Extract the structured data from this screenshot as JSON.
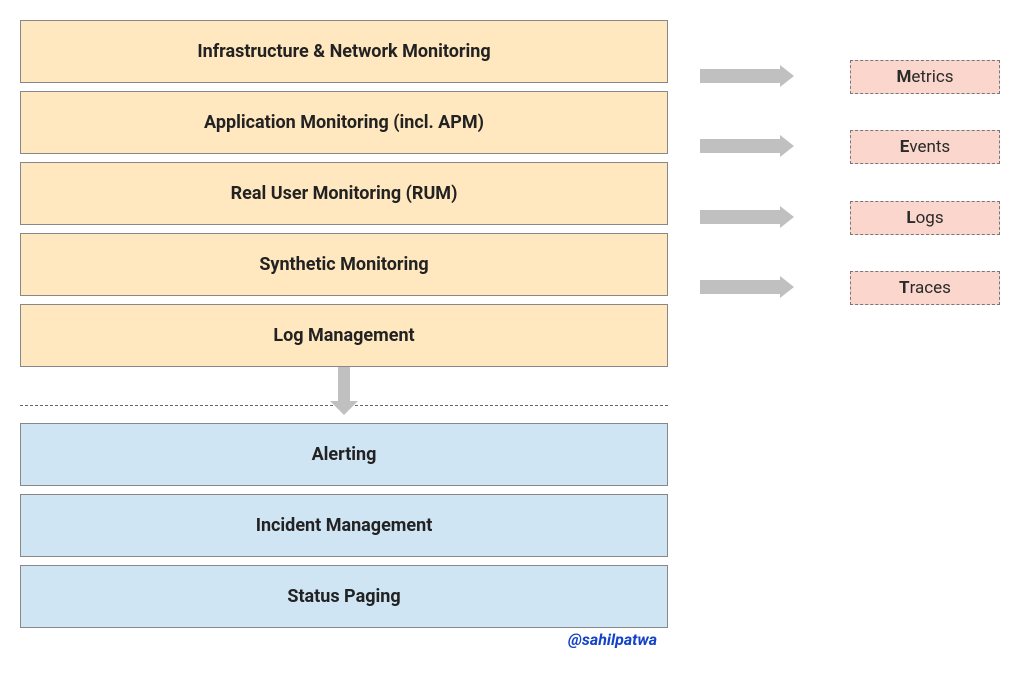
{
  "topStack": [
    "Infrastructure & Network Monitoring",
    "Application Monitoring (incl. APM)",
    "Real User Monitoring (RUM)",
    "Synthetic Monitoring",
    "Log Management"
  ],
  "bottomStack": [
    "Alerting",
    "Incident Management",
    "Status Paging"
  ],
  "pills": [
    {
      "lead": "M",
      "rest": "etrics"
    },
    {
      "lead": "E",
      "rest": "vents"
    },
    {
      "lead": "L",
      "rest": "ogs"
    },
    {
      "lead": "T",
      "rest": "races"
    }
  ],
  "attribution": "@sahilpatwa"
}
